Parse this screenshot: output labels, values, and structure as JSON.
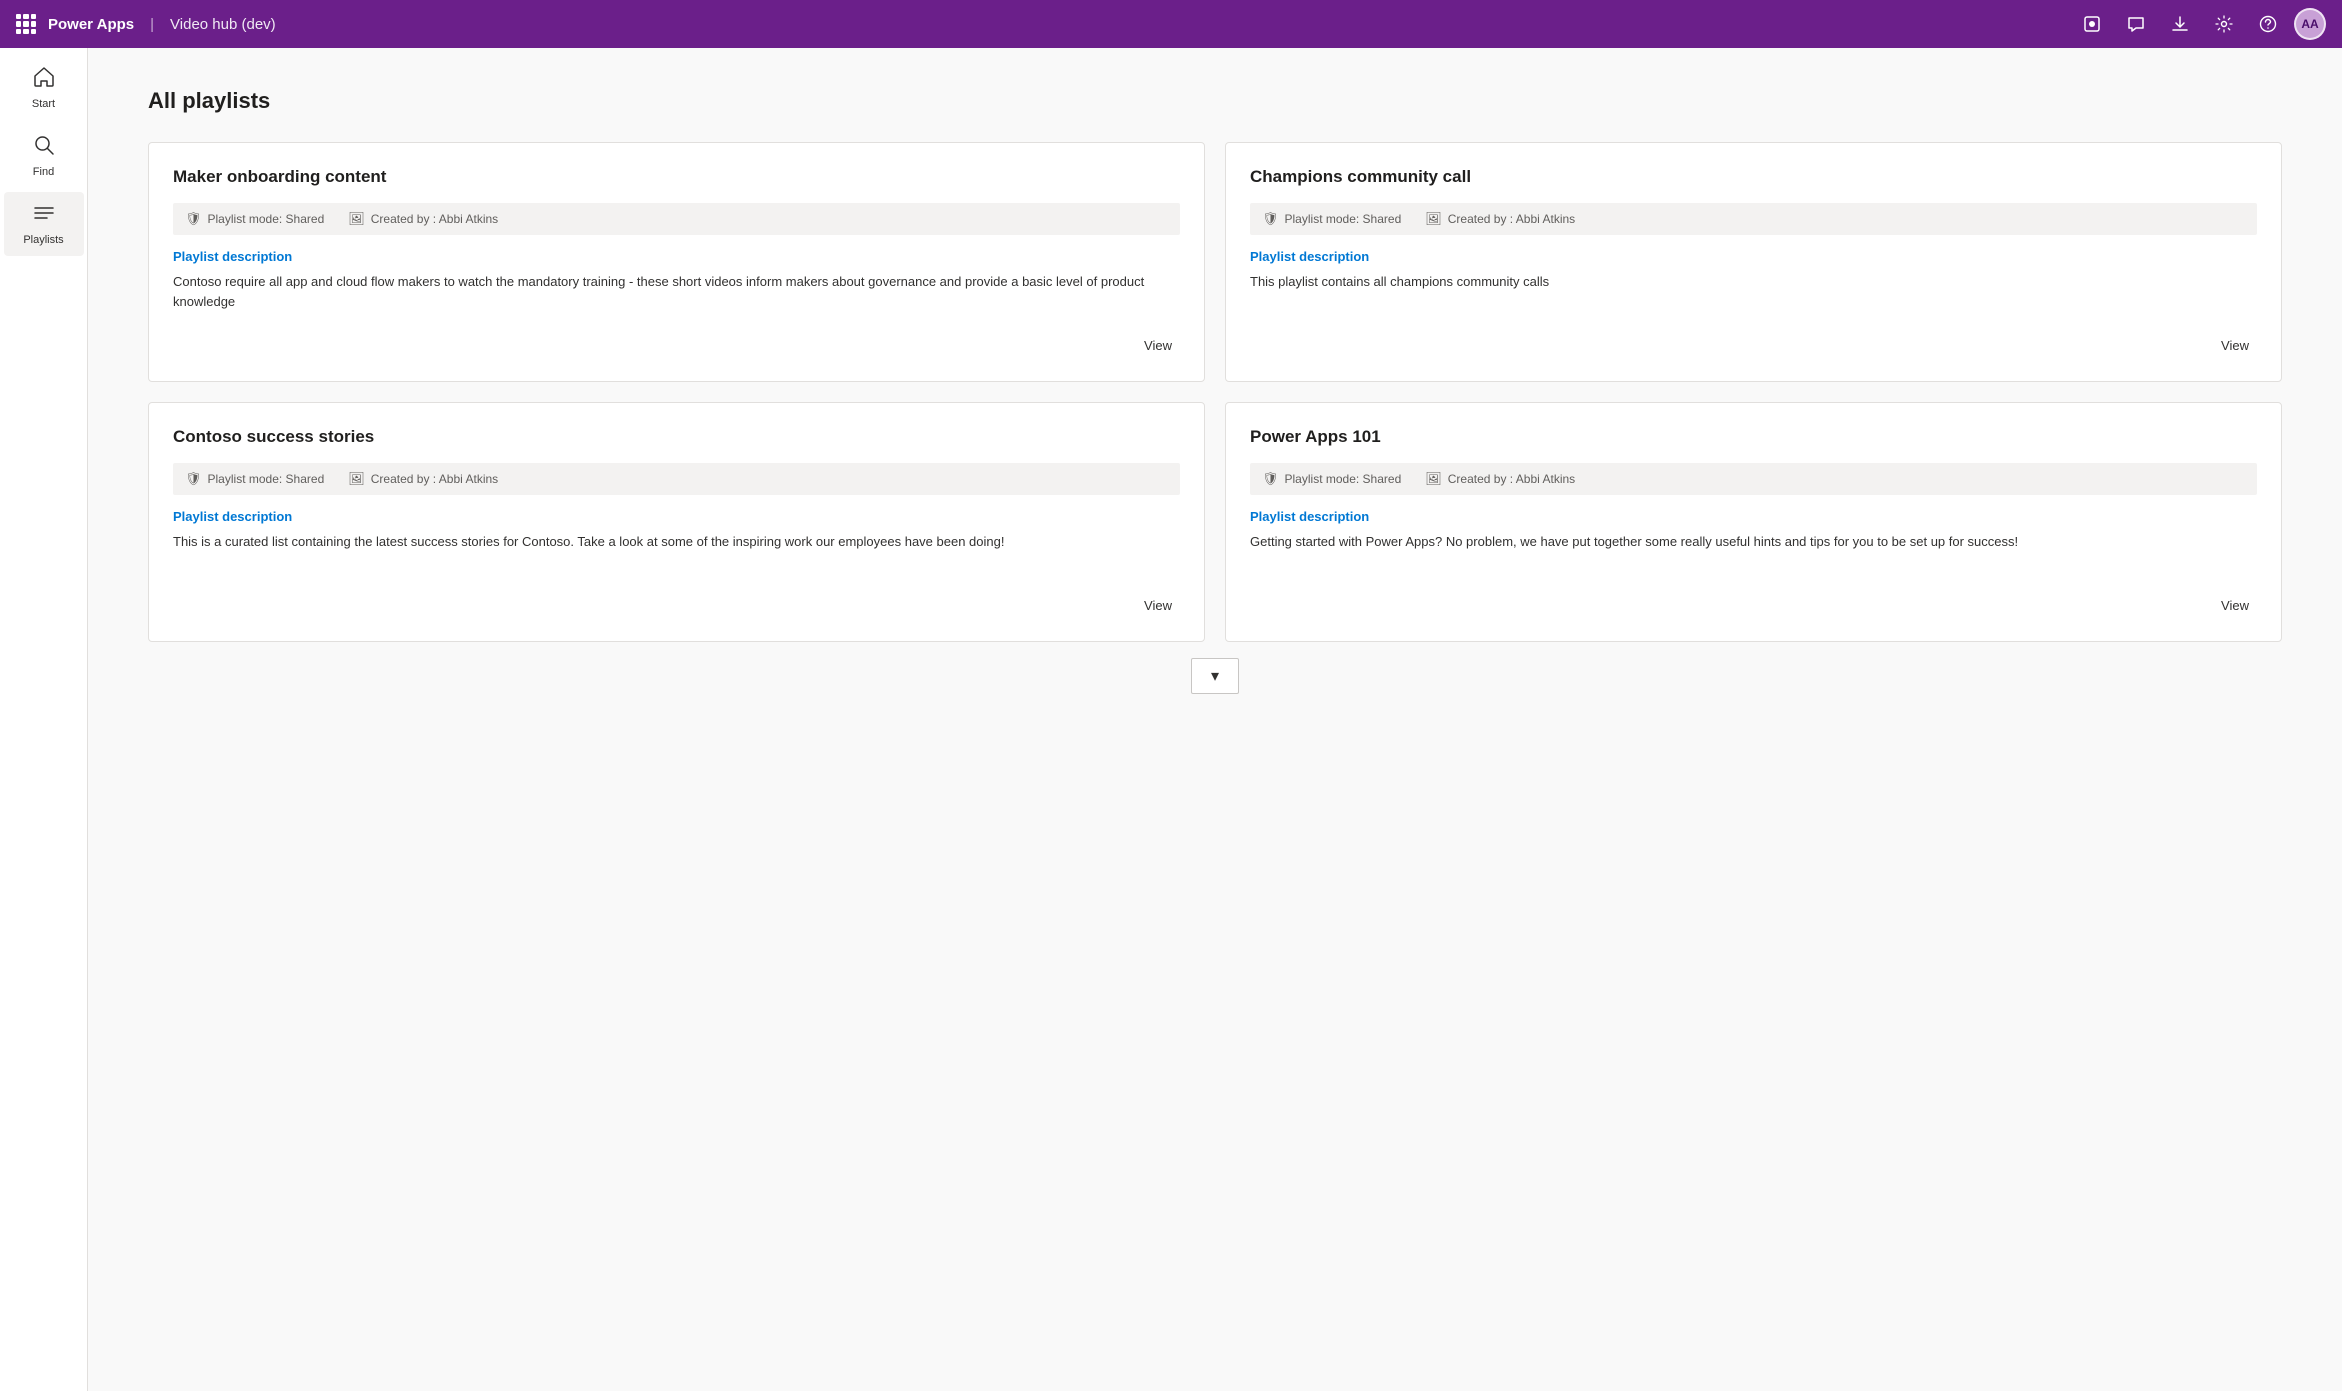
{
  "topbar": {
    "app_name": "Power Apps",
    "separator": "|",
    "app_subtitle": "Video hub (dev)",
    "icons": {
      "publish": "📦",
      "chat": "💬",
      "download": "⬇",
      "settings": "⚙",
      "help": "?",
      "avatar_initials": "AA"
    }
  },
  "sidebar": {
    "items": [
      {
        "id": "start",
        "label": "Start",
        "icon": "⌂"
      },
      {
        "id": "find",
        "label": "Find",
        "icon": "🔍"
      },
      {
        "id": "playlists",
        "label": "Playlists",
        "icon": "≡"
      }
    ]
  },
  "main": {
    "page_title": "All playlists",
    "playlists": [
      {
        "id": "maker-onboarding",
        "title": "Maker onboarding content",
        "mode_label": "Playlist mode: Shared",
        "created_label": "Created by : Abbi Atkins",
        "desc_heading": "Playlist description",
        "description": "Contoso require all app and cloud flow makers to watch the mandatory training - these short videos inform makers about governance and provide a basic level of product knowledge",
        "view_label": "View"
      },
      {
        "id": "champions-community",
        "title": "Champions community call",
        "mode_label": "Playlist mode: Shared",
        "created_label": "Created by : Abbi Atkins",
        "desc_heading": "Playlist description",
        "description": "This playlist contains all champions community calls",
        "view_label": "View"
      },
      {
        "id": "contoso-success",
        "title": "Contoso success stories",
        "mode_label": "Playlist mode: Shared",
        "created_label": "Created by : Abbi Atkins",
        "desc_heading": "Playlist description",
        "description": "This is a curated list containing the latest success stories for Contoso.  Take a look at some of the inspiring work our employees have been doing!",
        "view_label": "View"
      },
      {
        "id": "power-apps-101",
        "title": "Power Apps 101",
        "mode_label": "Playlist mode: Shared",
        "created_label": "Created by : Abbi Atkins",
        "desc_heading": "Playlist description",
        "description": "Getting started with Power Apps?  No problem, we have put together some really useful hints and tips for you to be set up for success!",
        "view_label": "View"
      }
    ],
    "scroll_down_label": "▾"
  }
}
